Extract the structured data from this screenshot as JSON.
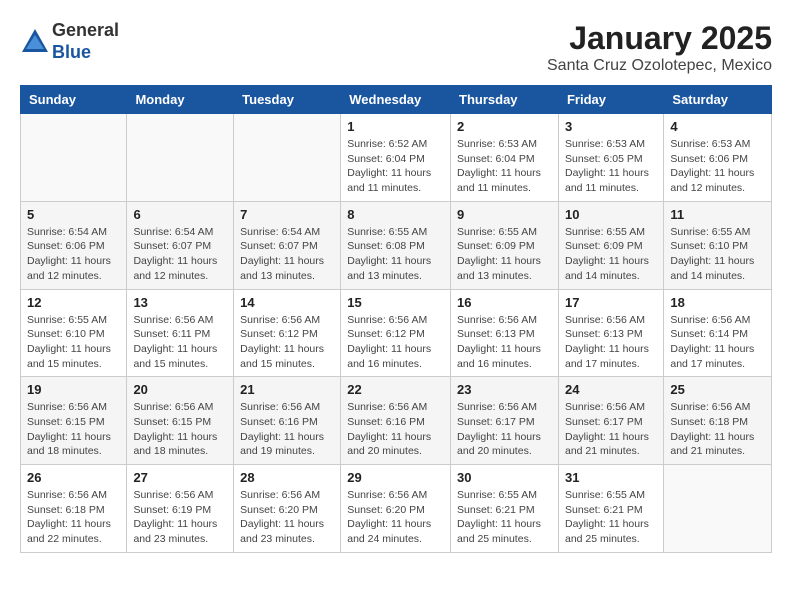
{
  "header": {
    "logo_general": "General",
    "logo_blue": "Blue",
    "month": "January 2025",
    "location": "Santa Cruz Ozolotepec, Mexico"
  },
  "days_of_week": [
    "Sunday",
    "Monday",
    "Tuesday",
    "Wednesday",
    "Thursday",
    "Friday",
    "Saturday"
  ],
  "weeks": [
    [
      {
        "day": "",
        "info": ""
      },
      {
        "day": "",
        "info": ""
      },
      {
        "day": "",
        "info": ""
      },
      {
        "day": "1",
        "info": "Sunrise: 6:52 AM\nSunset: 6:04 PM\nDaylight: 11 hours and 11 minutes."
      },
      {
        "day": "2",
        "info": "Sunrise: 6:53 AM\nSunset: 6:04 PM\nDaylight: 11 hours and 11 minutes."
      },
      {
        "day": "3",
        "info": "Sunrise: 6:53 AM\nSunset: 6:05 PM\nDaylight: 11 hours and 11 minutes."
      },
      {
        "day": "4",
        "info": "Sunrise: 6:53 AM\nSunset: 6:06 PM\nDaylight: 11 hours and 12 minutes."
      }
    ],
    [
      {
        "day": "5",
        "info": "Sunrise: 6:54 AM\nSunset: 6:06 PM\nDaylight: 11 hours and 12 minutes."
      },
      {
        "day": "6",
        "info": "Sunrise: 6:54 AM\nSunset: 6:07 PM\nDaylight: 11 hours and 12 minutes."
      },
      {
        "day": "7",
        "info": "Sunrise: 6:54 AM\nSunset: 6:07 PM\nDaylight: 11 hours and 13 minutes."
      },
      {
        "day": "8",
        "info": "Sunrise: 6:55 AM\nSunset: 6:08 PM\nDaylight: 11 hours and 13 minutes."
      },
      {
        "day": "9",
        "info": "Sunrise: 6:55 AM\nSunset: 6:09 PM\nDaylight: 11 hours and 13 minutes."
      },
      {
        "day": "10",
        "info": "Sunrise: 6:55 AM\nSunset: 6:09 PM\nDaylight: 11 hours and 14 minutes."
      },
      {
        "day": "11",
        "info": "Sunrise: 6:55 AM\nSunset: 6:10 PM\nDaylight: 11 hours and 14 minutes."
      }
    ],
    [
      {
        "day": "12",
        "info": "Sunrise: 6:55 AM\nSunset: 6:10 PM\nDaylight: 11 hours and 15 minutes."
      },
      {
        "day": "13",
        "info": "Sunrise: 6:56 AM\nSunset: 6:11 PM\nDaylight: 11 hours and 15 minutes."
      },
      {
        "day": "14",
        "info": "Sunrise: 6:56 AM\nSunset: 6:12 PM\nDaylight: 11 hours and 15 minutes."
      },
      {
        "day": "15",
        "info": "Sunrise: 6:56 AM\nSunset: 6:12 PM\nDaylight: 11 hours and 16 minutes."
      },
      {
        "day": "16",
        "info": "Sunrise: 6:56 AM\nSunset: 6:13 PM\nDaylight: 11 hours and 16 minutes."
      },
      {
        "day": "17",
        "info": "Sunrise: 6:56 AM\nSunset: 6:13 PM\nDaylight: 11 hours and 17 minutes."
      },
      {
        "day": "18",
        "info": "Sunrise: 6:56 AM\nSunset: 6:14 PM\nDaylight: 11 hours and 17 minutes."
      }
    ],
    [
      {
        "day": "19",
        "info": "Sunrise: 6:56 AM\nSunset: 6:15 PM\nDaylight: 11 hours and 18 minutes."
      },
      {
        "day": "20",
        "info": "Sunrise: 6:56 AM\nSunset: 6:15 PM\nDaylight: 11 hours and 18 minutes."
      },
      {
        "day": "21",
        "info": "Sunrise: 6:56 AM\nSunset: 6:16 PM\nDaylight: 11 hours and 19 minutes."
      },
      {
        "day": "22",
        "info": "Sunrise: 6:56 AM\nSunset: 6:16 PM\nDaylight: 11 hours and 20 minutes."
      },
      {
        "day": "23",
        "info": "Sunrise: 6:56 AM\nSunset: 6:17 PM\nDaylight: 11 hours and 20 minutes."
      },
      {
        "day": "24",
        "info": "Sunrise: 6:56 AM\nSunset: 6:17 PM\nDaylight: 11 hours and 21 minutes."
      },
      {
        "day": "25",
        "info": "Sunrise: 6:56 AM\nSunset: 6:18 PM\nDaylight: 11 hours and 21 minutes."
      }
    ],
    [
      {
        "day": "26",
        "info": "Sunrise: 6:56 AM\nSunset: 6:18 PM\nDaylight: 11 hours and 22 minutes."
      },
      {
        "day": "27",
        "info": "Sunrise: 6:56 AM\nSunset: 6:19 PM\nDaylight: 11 hours and 23 minutes."
      },
      {
        "day": "28",
        "info": "Sunrise: 6:56 AM\nSunset: 6:20 PM\nDaylight: 11 hours and 23 minutes."
      },
      {
        "day": "29",
        "info": "Sunrise: 6:56 AM\nSunset: 6:20 PM\nDaylight: 11 hours and 24 minutes."
      },
      {
        "day": "30",
        "info": "Sunrise: 6:55 AM\nSunset: 6:21 PM\nDaylight: 11 hours and 25 minutes."
      },
      {
        "day": "31",
        "info": "Sunrise: 6:55 AM\nSunset: 6:21 PM\nDaylight: 11 hours and 25 minutes."
      },
      {
        "day": "",
        "info": ""
      }
    ]
  ]
}
